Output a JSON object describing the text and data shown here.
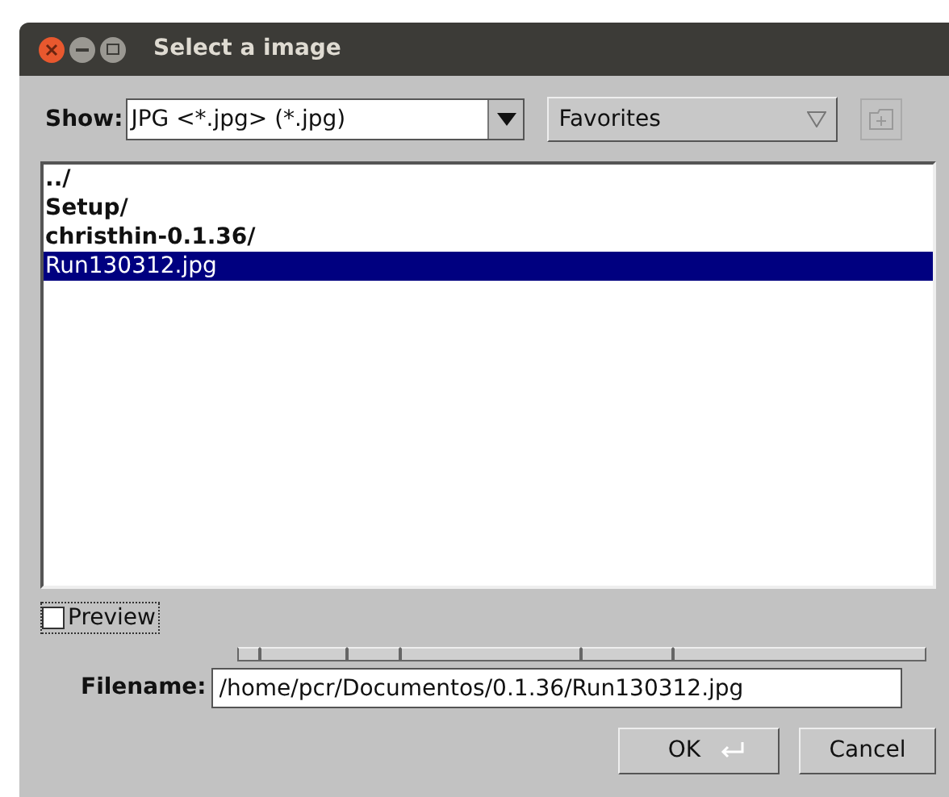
{
  "window": {
    "title": "Select a image"
  },
  "filter": {
    "label": "Show:",
    "value": "JPG <*.jpg> (*.jpg)"
  },
  "location": {
    "value": "Favorites"
  },
  "files": [
    {
      "name": "../",
      "kind": "folder",
      "selected": false
    },
    {
      "name": "Setup/",
      "kind": "folder",
      "selected": false
    },
    {
      "name": "christhin-0.1.36/",
      "kind": "folder",
      "selected": false
    },
    {
      "name": "Run130312.jpg",
      "kind": "file",
      "selected": true
    }
  ],
  "preview": {
    "label": "Preview",
    "checked": false
  },
  "filename": {
    "label": "Filename:",
    "value": "/home/pcr/Documentos/0.1.36/Run130312.jpg"
  },
  "buttons": [
    {
      "label": "OK",
      "kind": "default"
    },
    {
      "label": "Cancel",
      "kind": "plain"
    }
  ]
}
